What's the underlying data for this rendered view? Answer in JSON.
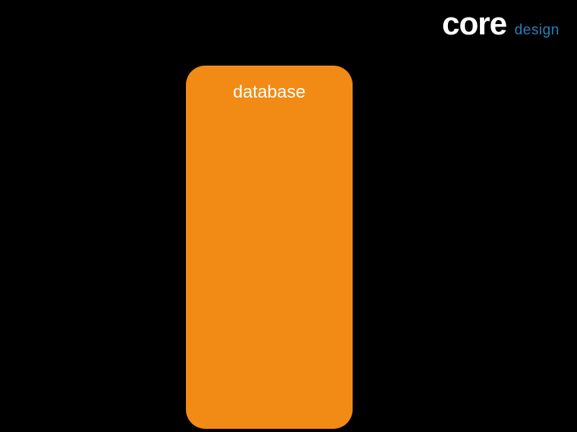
{
  "header": {
    "core": "core",
    "design": "design"
  },
  "panel": {
    "label": "database"
  },
  "colors": {
    "background": "#000000",
    "panel": "#f28a16",
    "design_text": "#2b7fb8"
  }
}
